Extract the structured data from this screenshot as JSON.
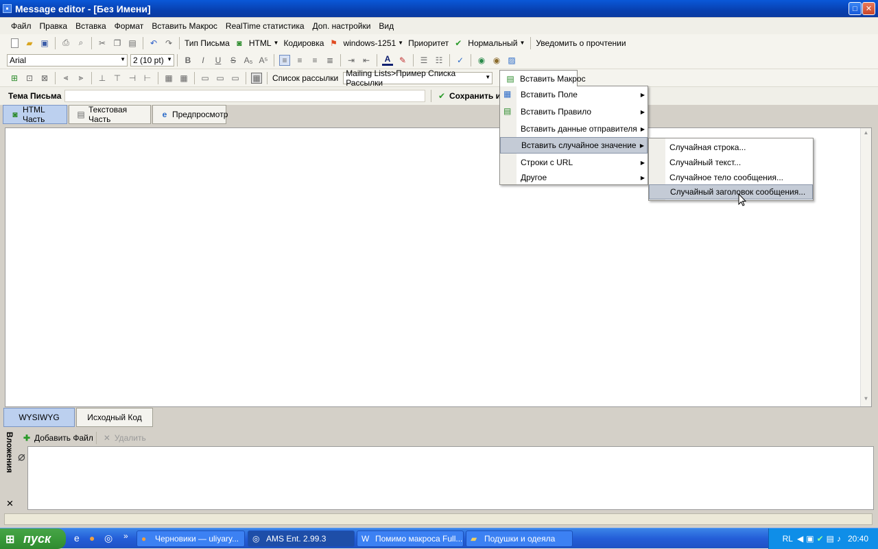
{
  "window": {
    "title": "Message editor - [Без Имени]"
  },
  "menubar": [
    "Файл",
    "Правка",
    "Вставка",
    "Формат",
    "Вставить Макрос",
    "RealTime статистика",
    "Доп. настройки",
    "Вид"
  ],
  "toolbar1": {
    "letter_type": "Тип Письма",
    "html": "HTML",
    "encoding_label": "Кодировка",
    "encoding_value": "windows-1251",
    "priority_label": "Приоритет",
    "priority_value": "Нормальный",
    "notify": "Уведомить о прочтении"
  },
  "toolbar2": {
    "font": "Arial",
    "size": "2 (10 pt)"
  },
  "toolbar3": {
    "mailing_label": "Список рассылки",
    "mailing_value": "Mailing Lists>Пример Списка Рассылки",
    "insert_macro": "Вставить Макрос"
  },
  "subject": {
    "label": "Тема Письма",
    "value": "",
    "save": "Сохранить и"
  },
  "tabs": [
    "HTML Часть",
    "Текстовая Часть",
    "Предпросмотр"
  ],
  "bottom_tabs": [
    "WYSIWYG",
    "Исходный Код"
  ],
  "attachments": {
    "side_label": "Вложения",
    "add": "Добавить Файл",
    "delete": "Удалить"
  },
  "macro_menu": [
    "Вставить Поле",
    "Вставить Правило",
    "Вставить данные отправителя",
    "Вставить случайное значение",
    "Строки с URL",
    "Другое"
  ],
  "random_submenu": [
    "Случайная строка...",
    "Случайный текст...",
    "Случайное тело сообщения...",
    "Случайный заголовок сообщения..."
  ],
  "taskbar": {
    "start": "пуск",
    "items": [
      "Черновики — uliyary...",
      "AMS Ent. 2.99.3",
      "Помимо макроса Full...",
      "Подушки и одеяла"
    ],
    "lang": "RL",
    "clock": "20:40"
  },
  "colors": {
    "title_blue": "#0a58d8",
    "menu_highlight": "#c4cbd6",
    "taskbar": "#245ed8",
    "start_green": "#3a9a3a"
  }
}
